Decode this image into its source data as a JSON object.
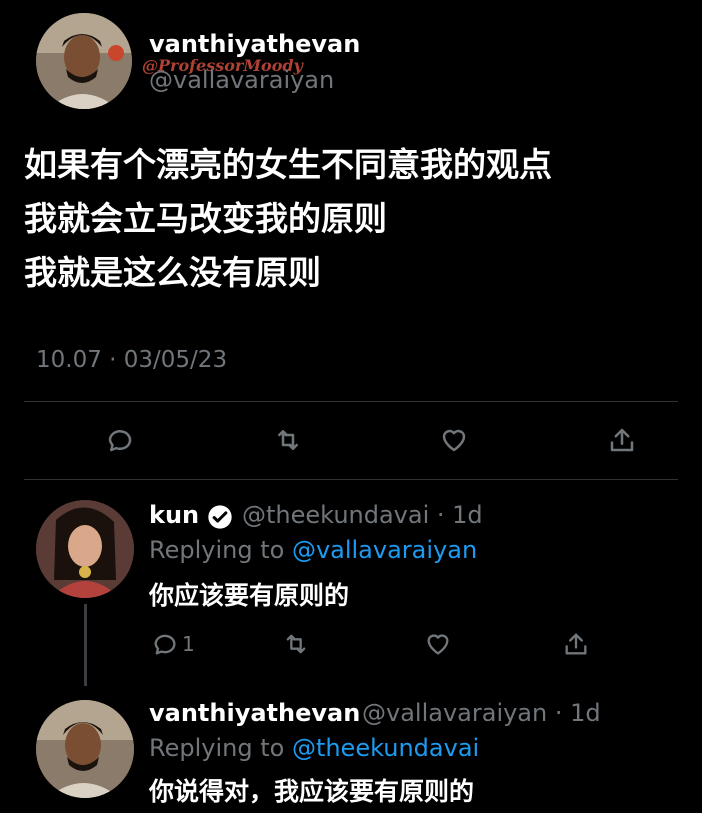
{
  "main_tweet": {
    "display_name": "vanthiyathevan",
    "handle": "@vallavaraiyan",
    "watermark": "@ProfessorMoody",
    "lines": [
      "如果有个漂亮的女生不同意我的观点",
      "我就会立马改变我的原则",
      "我就是这么没有原则"
    ],
    "meta": "10.07 · 03/05/23"
  },
  "actions": {
    "reply_icon": "speech-bubble-icon",
    "retweet_icon": "retweet-icon",
    "like_icon": "heart-icon",
    "share_icon": "share-icon"
  },
  "reply1": {
    "display_name": "kun",
    "handle_time": "@theekundavai · 1d",
    "replying_prefix": "Replying to ",
    "replying_to": "@vallavaraiyan",
    "text": "你应该要有原则的",
    "reply_count": "1"
  },
  "reply2": {
    "display_name": "vanthiyathevan",
    "handle_time": "@vallavaraiyan · 1d",
    "replying_prefix": "Replying to ",
    "replying_to": "@theekundavai",
    "text": "你说得对，我应该要有原则的"
  },
  "colors": {
    "background": "#000000",
    "link": "#1d9bf0",
    "secondary": "#71767b"
  }
}
